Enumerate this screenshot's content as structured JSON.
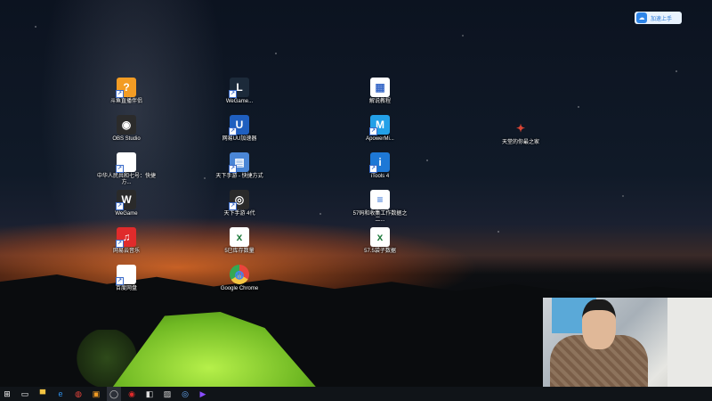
{
  "desktop_icons": [
    {
      "name": "icon-zhibo",
      "label": "斗鱼直播伴侣",
      "color": "#f39c24",
      "glyph": "?"
    },
    {
      "name": "icon-obs",
      "label": "OBS Studio",
      "color": "#2b2b2b",
      "glyph": "◉"
    },
    {
      "name": "icon-doc1",
      "label": "中华人民共和七号：快捷方...",
      "color": "#ffffff",
      "glyph": "▣"
    },
    {
      "name": "icon-wegame",
      "label": "WeGame",
      "color": "#2a2a2a",
      "glyph": "W"
    },
    {
      "name": "icon-netease-music",
      "label": "网易云音乐",
      "color": "#e02b2b",
      "glyph": "♫"
    },
    {
      "name": "icon-baidu-netdisk",
      "label": "百度网盘",
      "color": "#ffffff",
      "glyph": "☁"
    },
    {
      "name": "icon-lol",
      "label": "WeGame...",
      "color": "#1c2a3a",
      "glyph": "L"
    },
    {
      "name": "icon-uu",
      "label": "网易UU加速器",
      "color": "#1f5fbf",
      "glyph": "U"
    },
    {
      "name": "icon-app2",
      "label": "天下手游 - 快捷方式",
      "color": "#4a86d6",
      "glyph": "▤"
    },
    {
      "name": "icon-app3",
      "label": "天下手游 4代",
      "color": "#2a2a2a",
      "glyph": "◎"
    },
    {
      "name": "icon-excel1",
      "label": "5已库存数量",
      "color": "#ffffff",
      "glyph": "x"
    },
    {
      "name": "icon-chrome",
      "label": "Google Chrome",
      "color": "#ffffff",
      "glyph": "◍"
    },
    {
      "name": "icon-recycle",
      "label": "解说教程",
      "color": "#ffffff",
      "glyph": "▦"
    },
    {
      "name": "icon-apower",
      "label": "ApowerMi...",
      "color": "#23a0e8",
      "glyph": "M"
    },
    {
      "name": "icon-itools",
      "label": "iTools 4",
      "color": "#1e78d6",
      "glyph": "i"
    },
    {
      "name": "icon-file1",
      "label": "57码和收集工作数据之二...",
      "color": "#ffffff",
      "glyph": "≡"
    },
    {
      "name": "icon-excel2",
      "label": "57.5袋子数据",
      "color": "#ffffff",
      "glyph": "x"
    },
    {
      "name": "icon-game",
      "label": "天堂的你最之家",
      "color": "#c23b2e",
      "glyph": "✦"
    }
  ],
  "baidu_button": {
    "label": "加速上手"
  },
  "taskbar": [
    {
      "name": "start-button",
      "glyph": "⊞",
      "color": "#ffffff"
    },
    {
      "name": "task-view-button",
      "glyph": "▭",
      "color": "#ffffff"
    },
    {
      "name": "taskbar-explorer",
      "glyph": "▀",
      "color": "#f4c542"
    },
    {
      "name": "taskbar-edge",
      "glyph": "e",
      "color": "#2d8ee8"
    },
    {
      "name": "taskbar-chrome",
      "glyph": "◍",
      "color": "#e8453c"
    },
    {
      "name": "taskbar-zhibo",
      "glyph": "▣",
      "color": "#f39c24"
    },
    {
      "name": "taskbar-obs",
      "glyph": "◯",
      "color": "#cccccc"
    },
    {
      "name": "taskbar-netease",
      "glyph": "◉",
      "color": "#e02b2b"
    },
    {
      "name": "taskbar-app1",
      "glyph": "◧",
      "color": "#dddddd"
    },
    {
      "name": "taskbar-app2",
      "glyph": "▨",
      "color": "#dddddd"
    },
    {
      "name": "taskbar-app3",
      "glyph": "◎",
      "color": "#6ab0ff"
    },
    {
      "name": "taskbar-app4",
      "glyph": "▶",
      "color": "#8a4dff"
    }
  ]
}
